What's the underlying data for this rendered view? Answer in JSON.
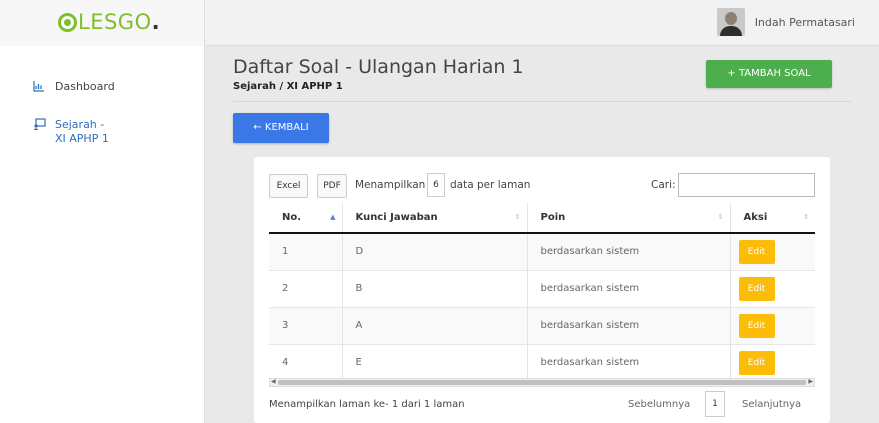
{
  "brand": {
    "logo_text": "LESGO",
    "logo_dot": "."
  },
  "user": {
    "name": "Indah Permatasari"
  },
  "sidebar": {
    "items": [
      {
        "label": "Dashboard",
        "icon": "chart-icon"
      },
      {
        "label": "Sejarah - XI APHP 1",
        "icon": "teacher-board-icon",
        "active": true
      }
    ]
  },
  "page": {
    "title": "Daftar Soal - Ulangan Harian 1",
    "subtitle": "Sejarah / XI APHP 1",
    "add_button": "+ TAMBAH SOAL",
    "back_button": "← KEMBALI"
  },
  "table_tools": {
    "excel": "Excel",
    "pdf": "PDF",
    "show_prefix": "Menampilkan",
    "page_length": "6",
    "show_suffix": "data per laman",
    "search_label": "Cari:",
    "search_value": ""
  },
  "table": {
    "columns": [
      "No.",
      "Kunci Jawaban",
      "Poin",
      "Aksi"
    ],
    "rows": [
      {
        "no": "1",
        "kunci": "D",
        "poin": "berdasarkan sistem",
        "aksi": "Edit"
      },
      {
        "no": "2",
        "kunci": "B",
        "poin": "berdasarkan sistem",
        "aksi": "Edit"
      },
      {
        "no": "3",
        "kunci": "A",
        "poin": "berdasarkan sistem",
        "aksi": "Edit"
      },
      {
        "no": "4",
        "kunci": "E",
        "poin": "berdasarkan sistem",
        "aksi": "Edit"
      }
    ]
  },
  "pagination": {
    "info": "Menampilkan laman ke- 1 dari 1 laman",
    "previous": "Sebelumnya",
    "current": "1",
    "next": "Selanjutnya"
  },
  "colors": {
    "brand_green": "#7fbf2a",
    "add_button": "#4cae4c",
    "back_button": "#3b78e7",
    "edit_button": "#fbbd08",
    "sidebar_active": "#2c6fbb"
  }
}
